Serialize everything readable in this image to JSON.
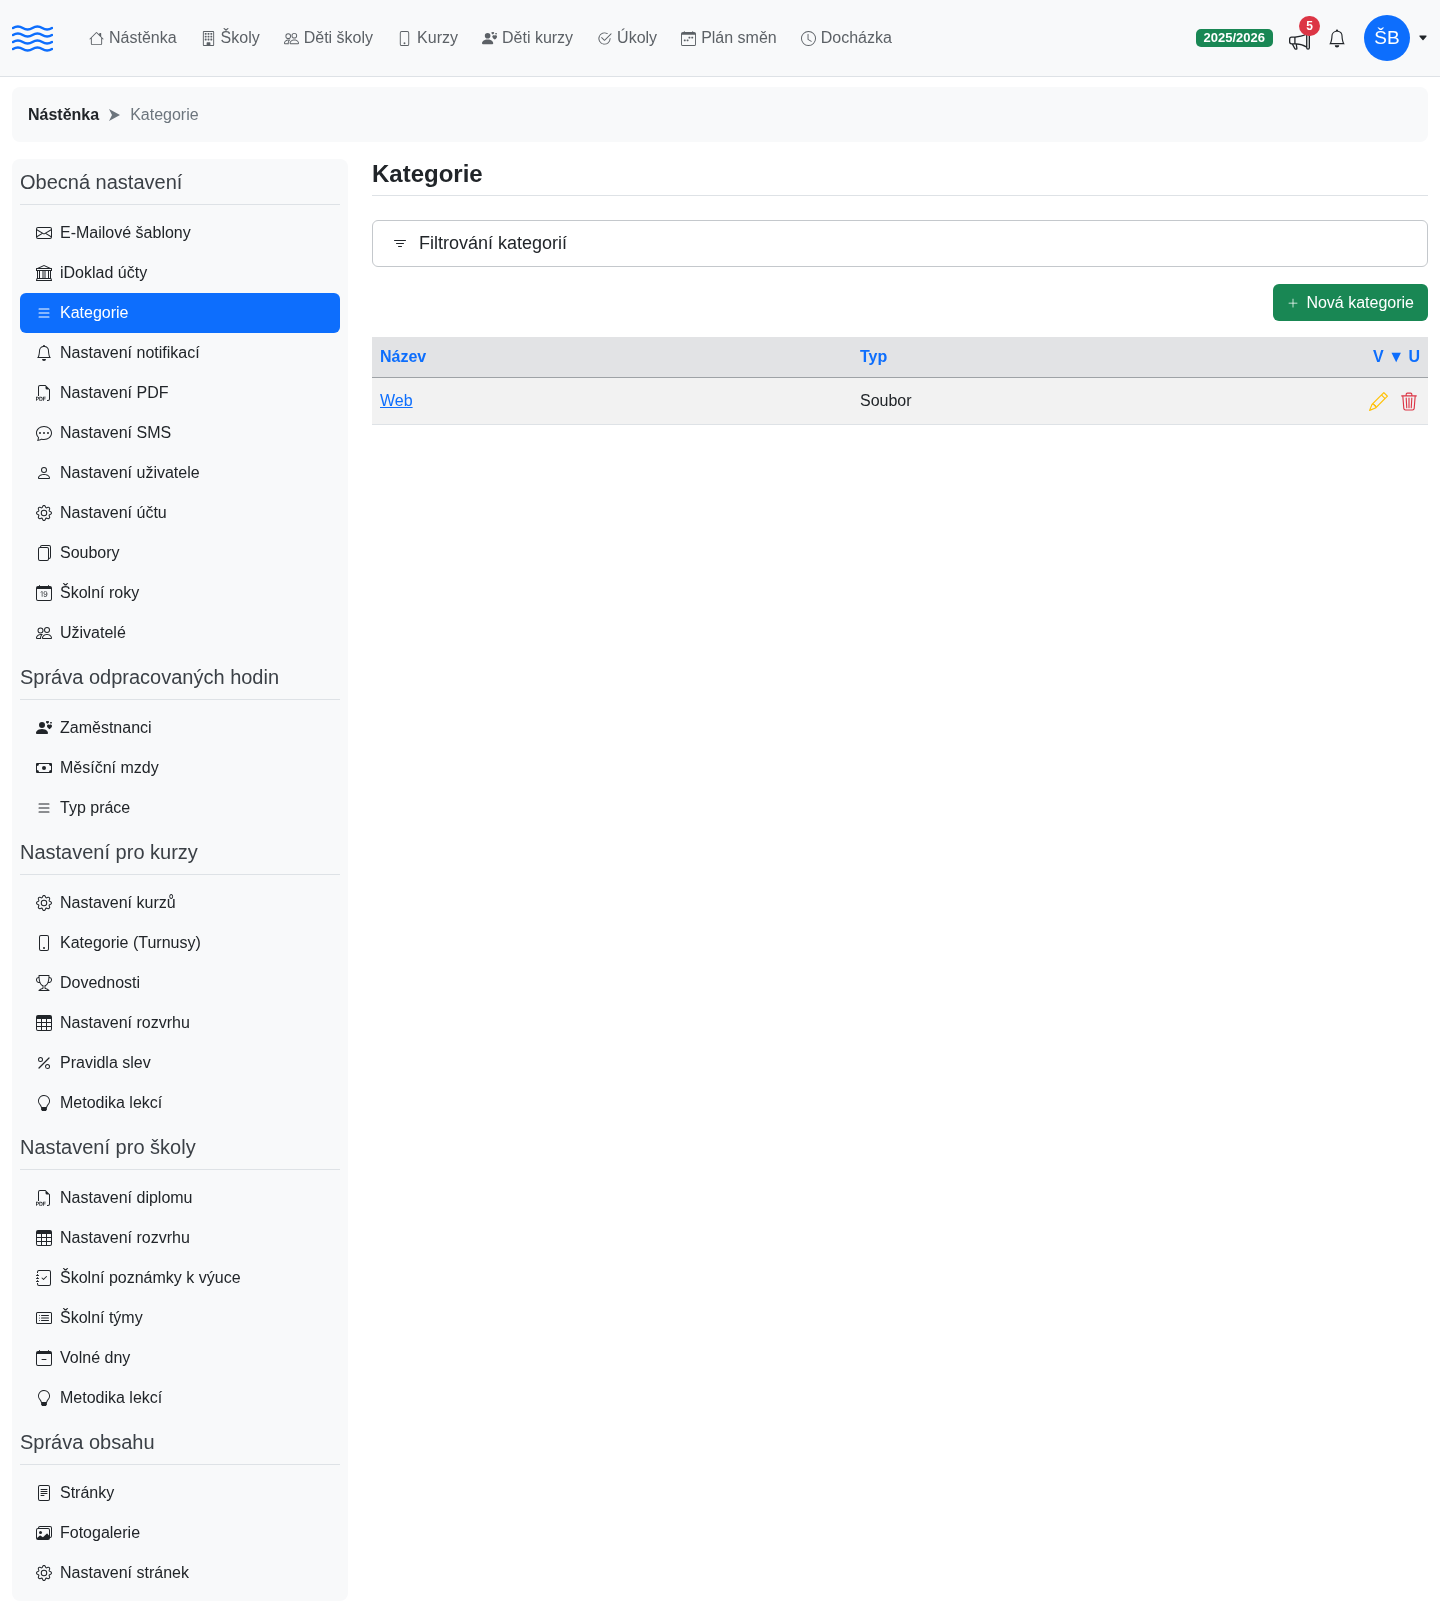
{
  "navbar": {
    "links": [
      "Nástěnka",
      "Školy",
      "Děti školy",
      "Kurzy",
      "Děti kurzy",
      "Úkoly",
      "Plán směn",
      "Docházka"
    ],
    "school_year": "2025/2026",
    "announcements_count": "5",
    "user_initials": "ŠB"
  },
  "breadcrumb": [
    {
      "label": "Nástěnka",
      "current": false
    },
    {
      "label": "Kategorie",
      "current": true
    }
  ],
  "sidebar": {
    "sections": [
      {
        "title": "Obecná nastavení",
        "items": [
          {
            "label": "E-Mailové šablony",
            "selected": false
          },
          {
            "label": "iDoklad účty",
            "selected": false
          },
          {
            "label": "Kategorie",
            "selected": true
          },
          {
            "label": "Nastavení notifikací",
            "selected": false
          },
          {
            "label": "Nastavení PDF",
            "selected": false
          },
          {
            "label": "Nastavení SMS",
            "selected": false
          },
          {
            "label": "Nastavení uživatele",
            "selected": false
          },
          {
            "label": "Nastavení účtu",
            "selected": false
          },
          {
            "label": "Soubory",
            "selected": false
          },
          {
            "label": "Školní roky",
            "selected": false
          },
          {
            "label": "Uživatelé",
            "selected": false
          }
        ]
      },
      {
        "title": "Správa odpracovaných hodin",
        "items": [
          {
            "label": "Zaměstnanci",
            "selected": false
          },
          {
            "label": "Měsíční mzdy",
            "selected": false
          },
          {
            "label": "Typ práce",
            "selected": false
          }
        ]
      },
      {
        "title": "Nastavení pro kurzy",
        "items": [
          {
            "label": "Nastavení kurzů",
            "selected": false
          },
          {
            "label": "Kategorie (Turnusy)",
            "selected": false
          },
          {
            "label": "Dovednosti",
            "selected": false
          },
          {
            "label": "Nastavení rozvrhu",
            "selected": false
          },
          {
            "label": "Pravidla slev",
            "selected": false
          },
          {
            "label": "Metodika lekcí",
            "selected": false
          }
        ]
      },
      {
        "title": "Nastavení pro školy",
        "items": [
          {
            "label": "Nastavení diplomu",
            "selected": false
          },
          {
            "label": "Nastavení rozvrhu",
            "selected": false
          },
          {
            "label": "Školní poznámky k výuce",
            "selected": false
          },
          {
            "label": "Školní týmy",
            "selected": false
          },
          {
            "label": "Volné dny",
            "selected": false
          },
          {
            "label": "Metodika lekcí",
            "selected": false
          }
        ]
      },
      {
        "title": "Správa obsahu",
        "items": [
          {
            "label": "Stránky",
            "selected": false
          },
          {
            "label": "Fotogalerie",
            "selected": false
          },
          {
            "label": "Nastavení stránek",
            "selected": false
          }
        ]
      }
    ]
  },
  "main": {
    "title": "Kategorie",
    "filter": {
      "label": "Filtrování kategorií"
    },
    "new_button": {
      "label": "Nová kategorie"
    },
    "table": {
      "columns": [
        "Název",
        "Typ",
        "V ▼ U"
      ],
      "rows": [
        {
          "cells": [
            "Web",
            "Soubor"
          ]
        }
      ]
    }
  }
}
